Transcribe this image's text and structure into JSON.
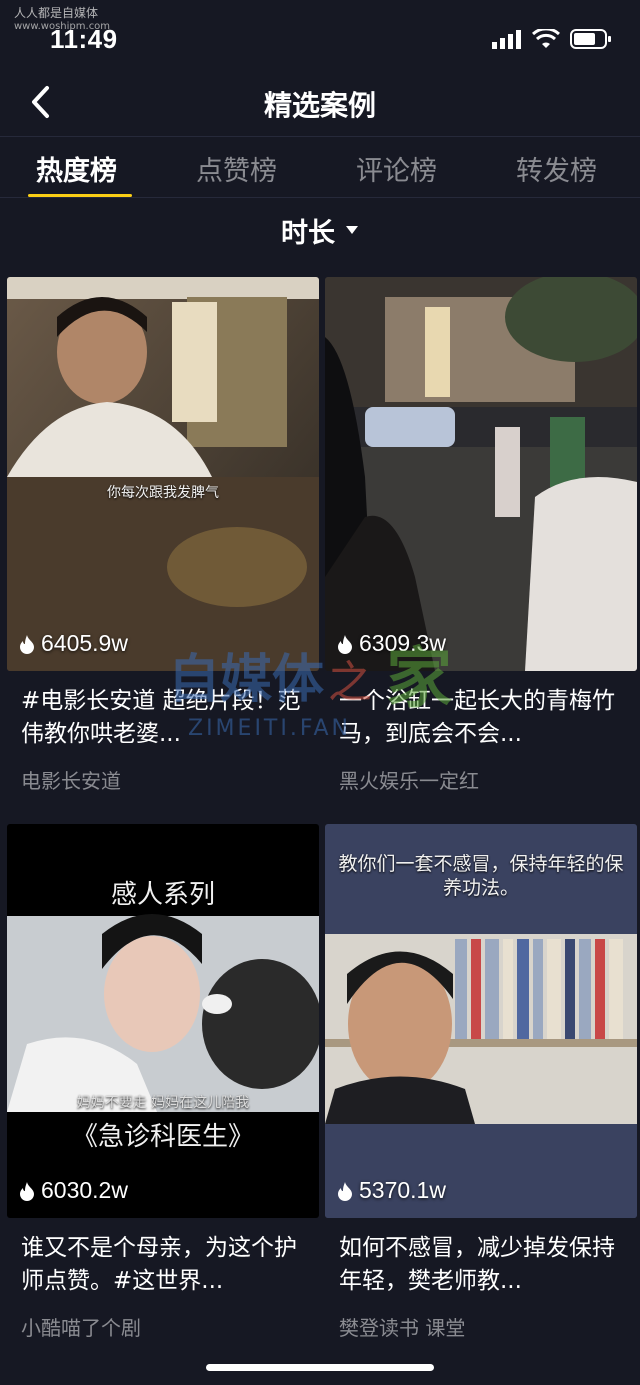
{
  "watermark": {
    "text": "人人都是自媒体",
    "url": "www.woshipm.com"
  },
  "status_bar": {
    "time": "11:49"
  },
  "nav": {
    "title": "精选案例"
  },
  "tabs": [
    {
      "label": "热度榜",
      "active": true
    },
    {
      "label": "点赞榜",
      "active": false
    },
    {
      "label": "评论榜",
      "active": false
    },
    {
      "label": "转发榜",
      "active": false
    }
  ],
  "sort": {
    "label": "时长"
  },
  "cards": [
    {
      "count": "6405.9w",
      "title": "#电影长安道 超绝片段！范伟教你哄老婆...",
      "author": "电影长安道",
      "overlay_text": "你每次跟我发脾气"
    },
    {
      "count": "6309.3w",
      "title": "一个浴缸一起长大的青梅竹马，到底会不会...",
      "author": "黑火娱乐一定红"
    },
    {
      "count": "6030.2w",
      "title": "谁又不是个母亲，为这个护师点赞。#这世界...",
      "author": "小酷喵了个剧",
      "overlay_heading": "感人系列",
      "overlay_sub": "妈妈不要走 妈妈在这儿陪我",
      "overlay_film": "《急诊科医生》"
    },
    {
      "count": "5370.1w",
      "title": "如何不感冒，减少掉发保持年轻，樊老师教...",
      "author": "樊登读书 课堂",
      "overlay_heading": "教你们一套不感冒，保持年轻的保养功法。"
    }
  ],
  "site_watermark": {
    "text": "自媒体之家",
    "url": "ZIMEITI.FAN"
  },
  "colors": {
    "background": "#161823",
    "tab_indicator": "#face15",
    "muted_text": "#8a8b91"
  }
}
